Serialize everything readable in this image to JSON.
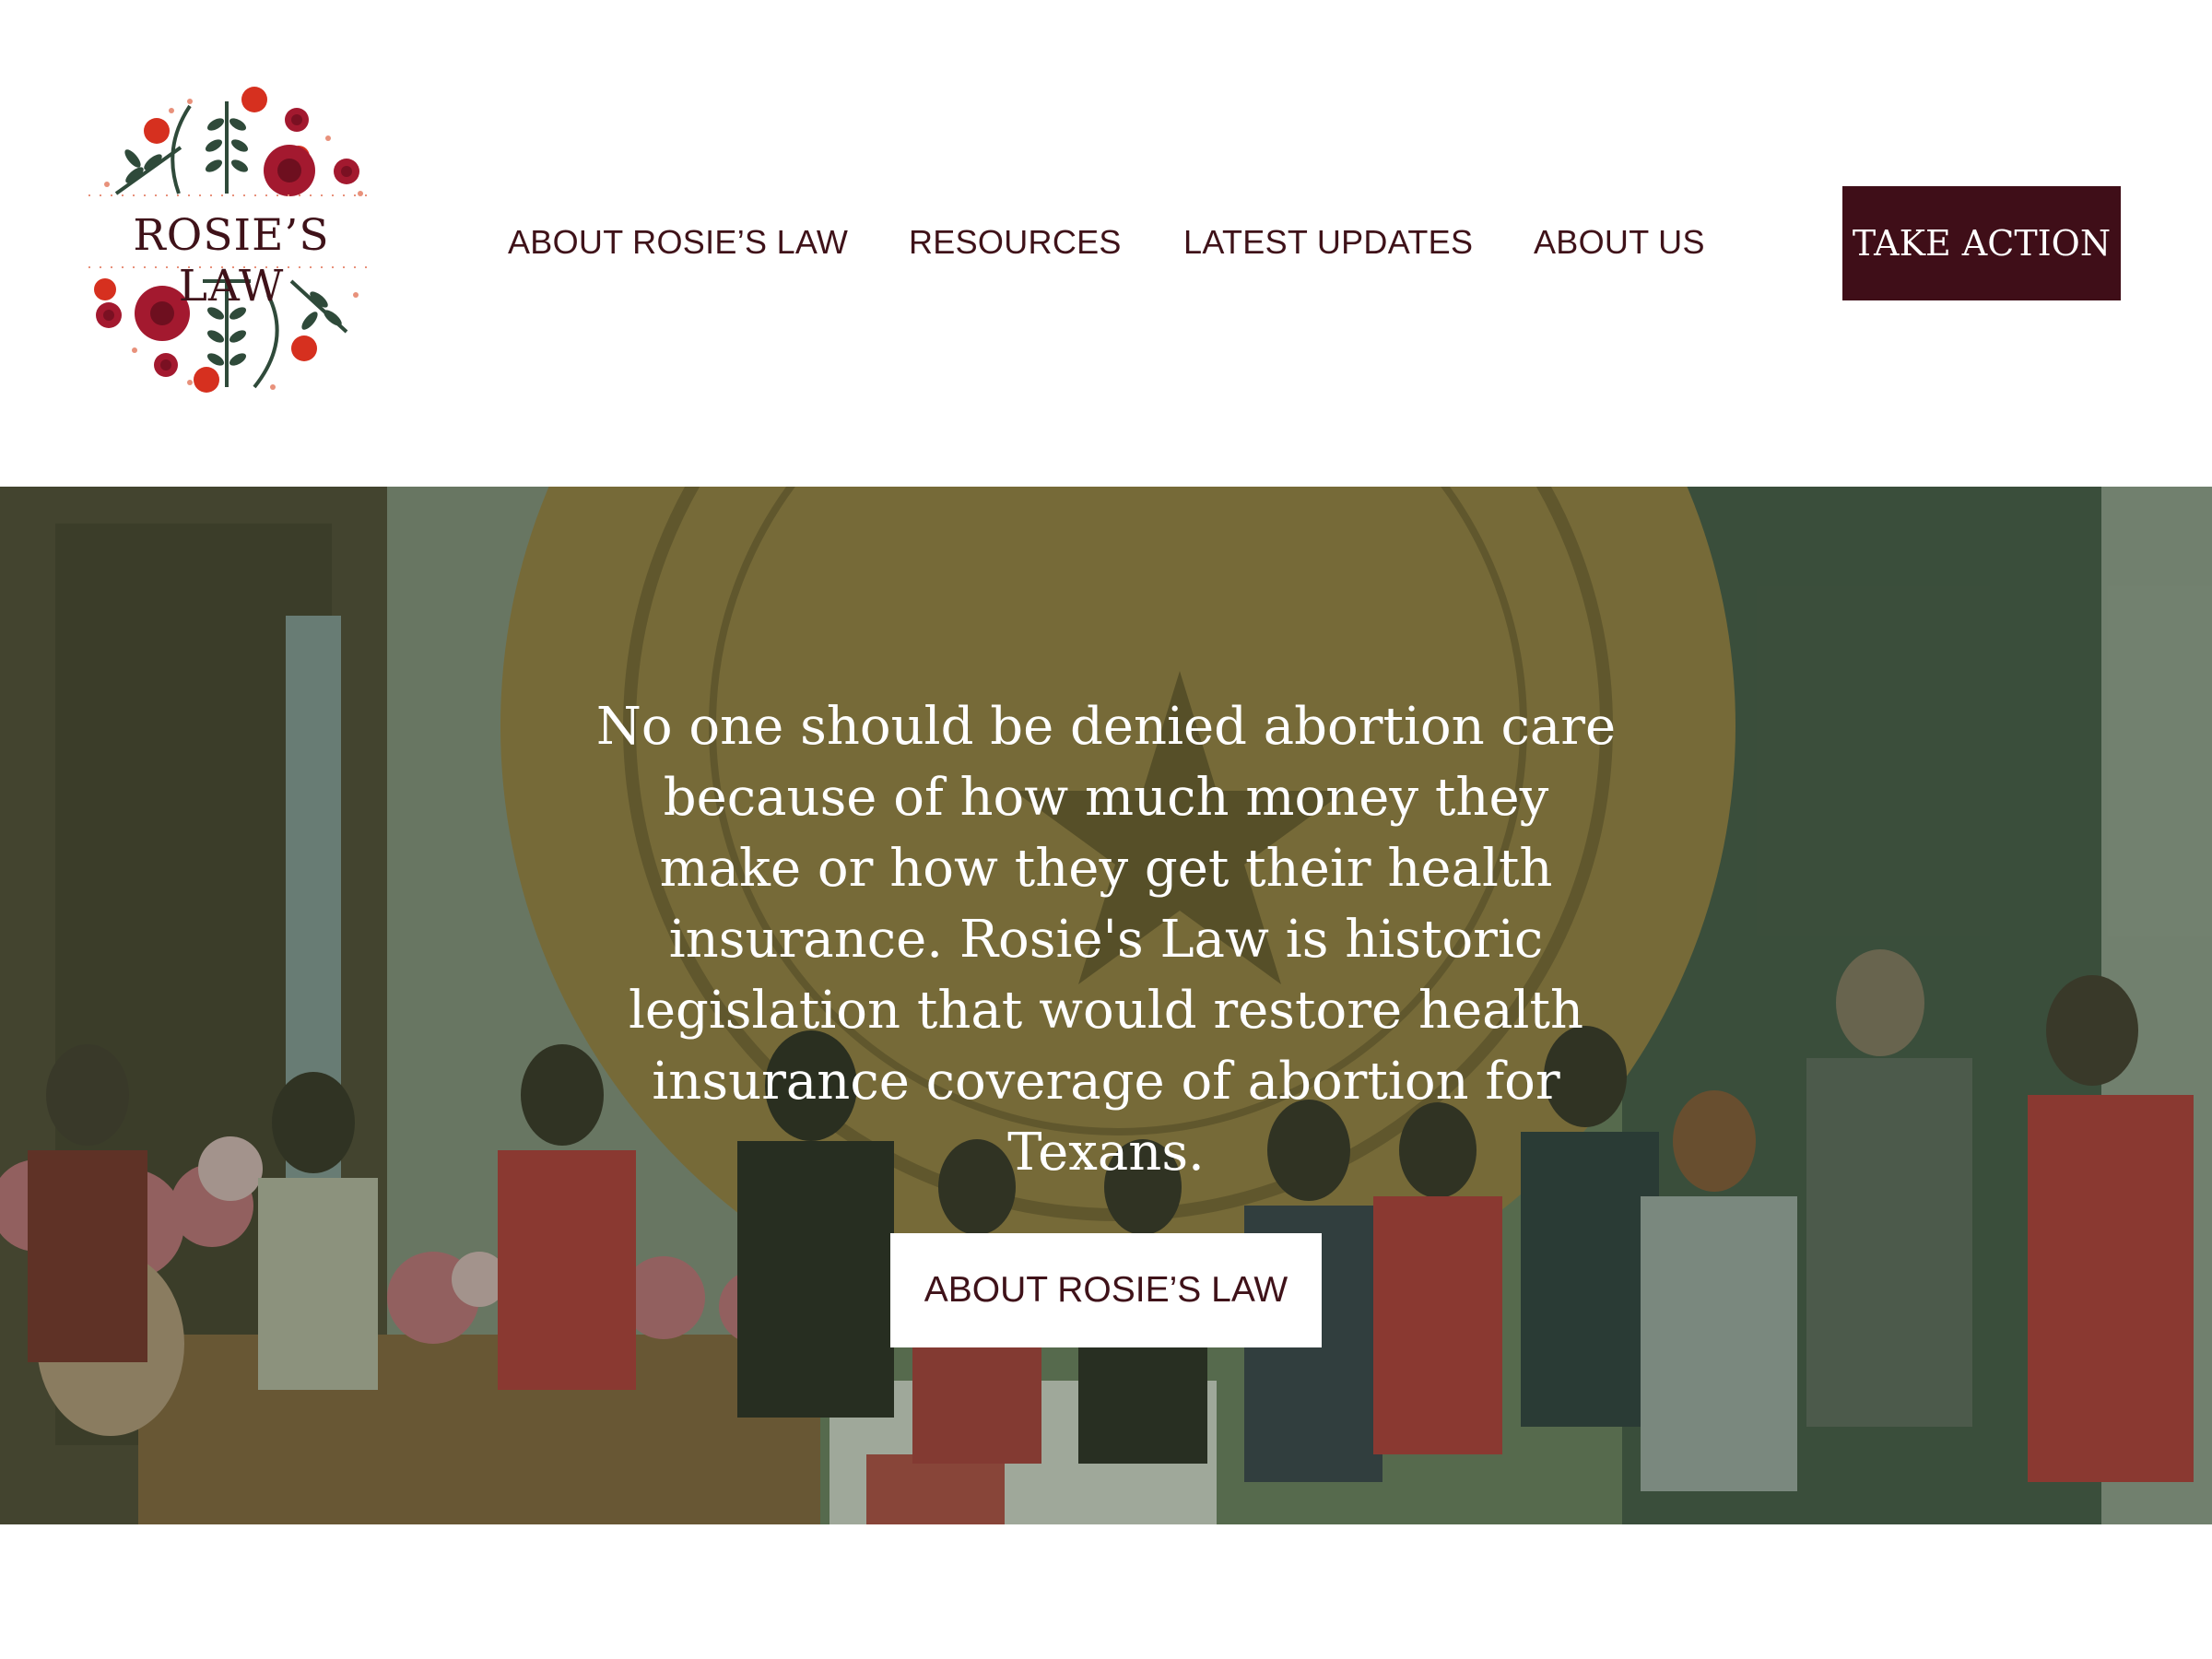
{
  "brand": {
    "logo_text": "ROSIE’S LAW",
    "colors": {
      "primary": "#3f0e18",
      "leaf": "#2f4a3a",
      "berry": "#d6301f",
      "rose": "#a3192f"
    }
  },
  "nav": {
    "items": [
      {
        "label": "ABOUT ROSIE’S LAW"
      },
      {
        "label": "RESOURCES"
      },
      {
        "label": "LATEST UPDATES"
      },
      {
        "label": "ABOUT US"
      }
    ],
    "cta_label": "TAKE ACTION"
  },
  "hero": {
    "headline": "No one should be denied abortion care because of how much money they make or how they get their health insurance. Rosie's Law is historic legislation that would restore health insurance coverage of abortion for Texans.",
    "button_label": "ABOUT ROSIE’S LAW",
    "background": "photo-of-press-conference-with-texas-state-seal",
    "overlay_color": "#3a5438"
  }
}
